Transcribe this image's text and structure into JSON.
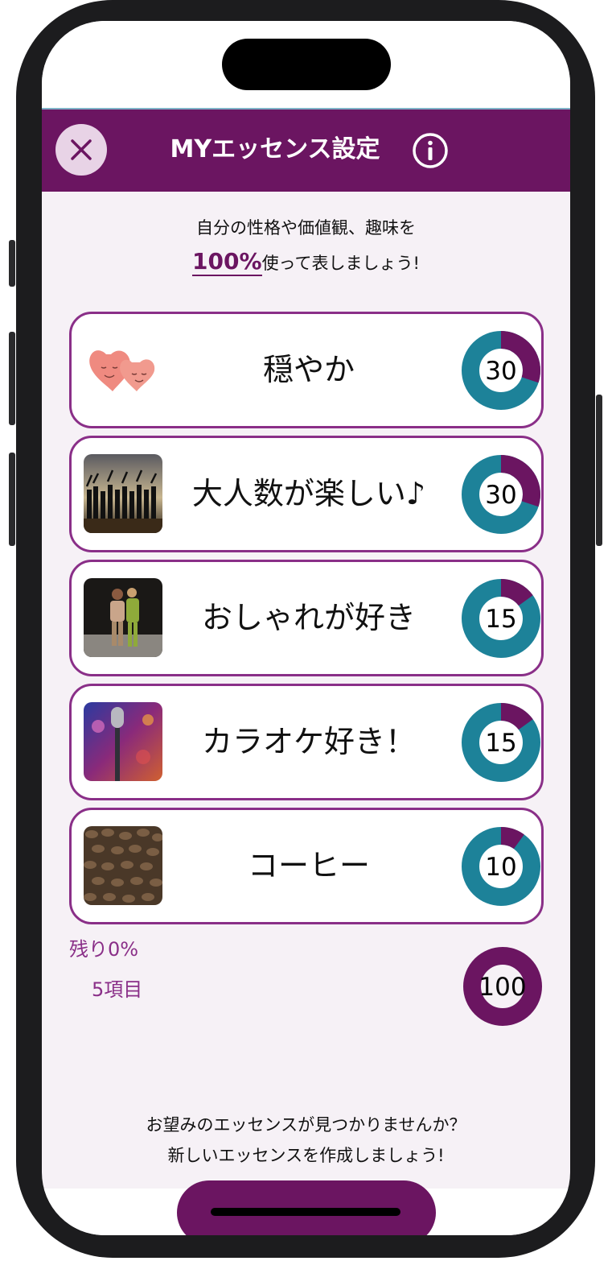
{
  "header": {
    "title": "MYエッセンス設定",
    "close_icon": "close-icon",
    "info_icon": "info-icon",
    "color": "#6b1561"
  },
  "intro": {
    "line1": "自分の性格や価値観、趣味を",
    "percent": "100%",
    "line2_rest": "使って表しましょう!"
  },
  "essences": [
    {
      "label": "穏やか",
      "value": 30,
      "image": "hearts-illustration"
    },
    {
      "label": "大人数が楽しい♪",
      "value": 30,
      "image": "crowd-photo"
    },
    {
      "label": "おしゃれが好き",
      "value": 15,
      "image": "fashion-couple-photo"
    },
    {
      "label": "カラオケ好き！",
      "value": 15,
      "image": "microphone-photo"
    },
    {
      "label": "コーヒー",
      "value": 10,
      "image": "coffee-beans-photo"
    }
  ],
  "summary": {
    "remaining": "残り0%",
    "item_count": "5項目",
    "total": 100
  },
  "footer": {
    "line1": "お望みのエッセンスが見つかりませんか？",
    "line2": "新しいエッセンスを作成しましょう!"
  },
  "colors": {
    "accent": "#6b1561",
    "card_border": "#8a2f88",
    "donut_track": "#1d8299",
    "donut_fill": "#6b1561"
  }
}
